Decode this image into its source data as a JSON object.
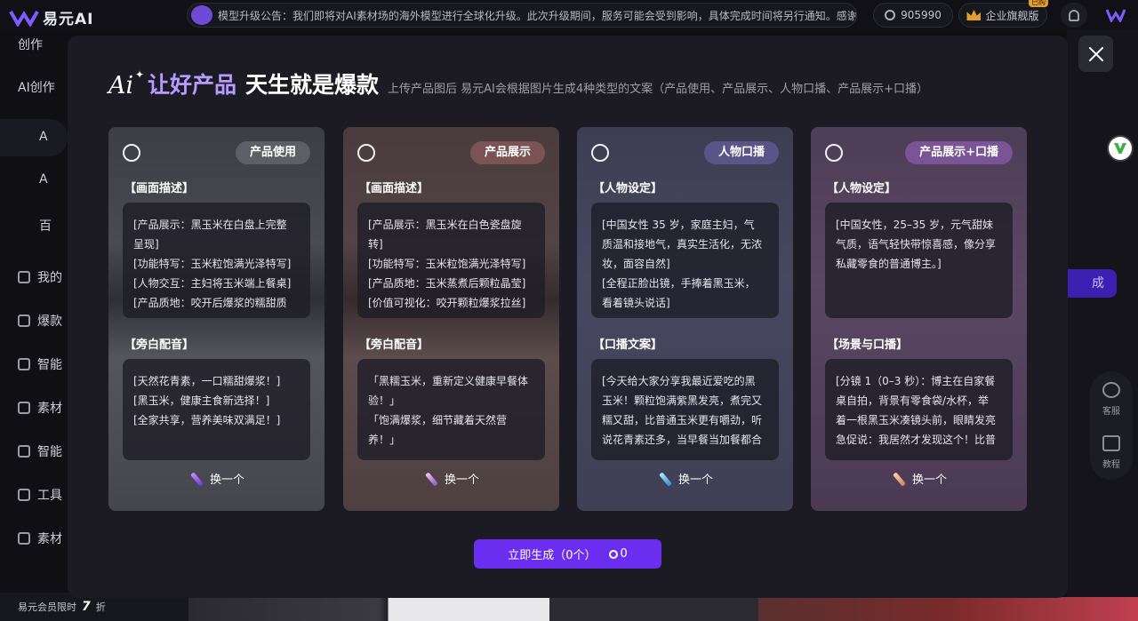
{
  "app": {
    "name": "易元AI"
  },
  "topbar": {
    "notice": "模型升级公告：我们即将对AI素材场的海外模型进行全球化升级。此次升级期间，服务可能会受到影响，具体完成时间将另行通知。感谢理解！",
    "coins": "905990",
    "vip_label": "企业旗舰版",
    "vip_tag": "已购"
  },
  "sidebar": {
    "items": [
      {
        "label": "创作"
      },
      {
        "label": "AI创作"
      },
      {
        "label": "A"
      },
      {
        "label": "A"
      },
      {
        "label": "百"
      },
      {
        "label": "我的"
      },
      {
        "label": "爆款"
      },
      {
        "label": "智能"
      },
      {
        "label": "素材"
      },
      {
        "label": "智能"
      },
      {
        "label": "工具"
      },
      {
        "label": "素材"
      }
    ]
  },
  "bottom_bar": {
    "text1": "易元会员限时",
    "num": "7",
    "text2": "折"
  },
  "background": {
    "pill": "成",
    "side_service": "客服",
    "side_tutorial": "教程"
  },
  "modal": {
    "title_highlight": "让好产品",
    "title_main": "天生就是爆款",
    "subtitle": "上传产品图后 易元AI会根据图片生成4种类型的文案（产品使用、产品展示、人物口播、产品展示+口播）",
    "cards": [
      {
        "tag": "产品使用",
        "section1_title": "【画面描述】",
        "section1_lines": [
          "[产品展示：黑玉米在白盘上完整",
          "呈现]",
          "[功能特写：玉米粒饱满光泽特写]",
          "[人物交互：主妇将玉米端上餐桌]",
          "[产品质地：咬开后爆浆的糯甜质"
        ],
        "section2_title": "【旁白配音】",
        "section2_lines": [
          "[天然花青素，一口糯甜爆浆！]",
          "[黑玉米，健康主食新选择！]",
          "[全家共享，营养美味双满足！]"
        ],
        "swap": "换一个"
      },
      {
        "tag": "产品展示",
        "section1_title": "【画面描述】",
        "section1_lines": [
          "[产品展示：黑玉米在白色瓷盘旋",
          "转]",
          "[功能特写：玉米粒饱满光泽特写]",
          "[产品质地：玉米蒸煮后颗粒晶莹]",
          "[价值可视化：咬开颗粒爆浆拉丝]"
        ],
        "section2_title": "【旁白配音】",
        "section2_lines": [
          "「黑糯玉米，重新定义健康早餐体",
          "验！」",
          "「饱满爆浆，细节藏着天然营",
          "养！」"
        ],
        "swap": "换一个"
      },
      {
        "tag": "人物口播",
        "section1_title": "【人物设定】",
        "section1_lines": [
          "[中国女性 35 岁，家庭主妇，气",
          "质温和接地气，真实生活化，无浓",
          "妆，面容自然]",
          "[全程正脸出镜，手捧着黑玉米，",
          "看着镜头说话]"
        ],
        "section2_title": "【口播文案】",
        "section2_lines": [
          "[今天给大家分享我最近爱吃的黑",
          "玉米！颗粒饱满紫黑发亮，煮完又",
          "糯又甜，比普通玉米更有嚼劲，听",
          "说花青素还多，当早餐当加餐都合"
        ],
        "swap": "换一个"
      },
      {
        "tag": "产品展示+口播",
        "section1_title": "【人物设定】",
        "section1_lines": [
          "[中国女性，25–35 岁，元气甜妹",
          "气质，语气轻快带惊喜感，像分享",
          "私藏零食的普通博主。]"
        ],
        "section2_title": "【场景与口播】",
        "section2_lines": [
          "[分镜 1（0–3 秒）：博主在自家餐",
          "桌自拍，背景有零食袋/水杯，举",
          "着一根黑玉米凑镜头前，眼睛发亮",
          "急促说：我居然才发现这个！比普"
        ],
        "swap": "换一个"
      }
    ],
    "generate_label": "立即生成（0个）",
    "generate_cost": "0"
  },
  "colors": {
    "accent": "#6b2df0",
    "title_highlight": "#b69cff"
  }
}
